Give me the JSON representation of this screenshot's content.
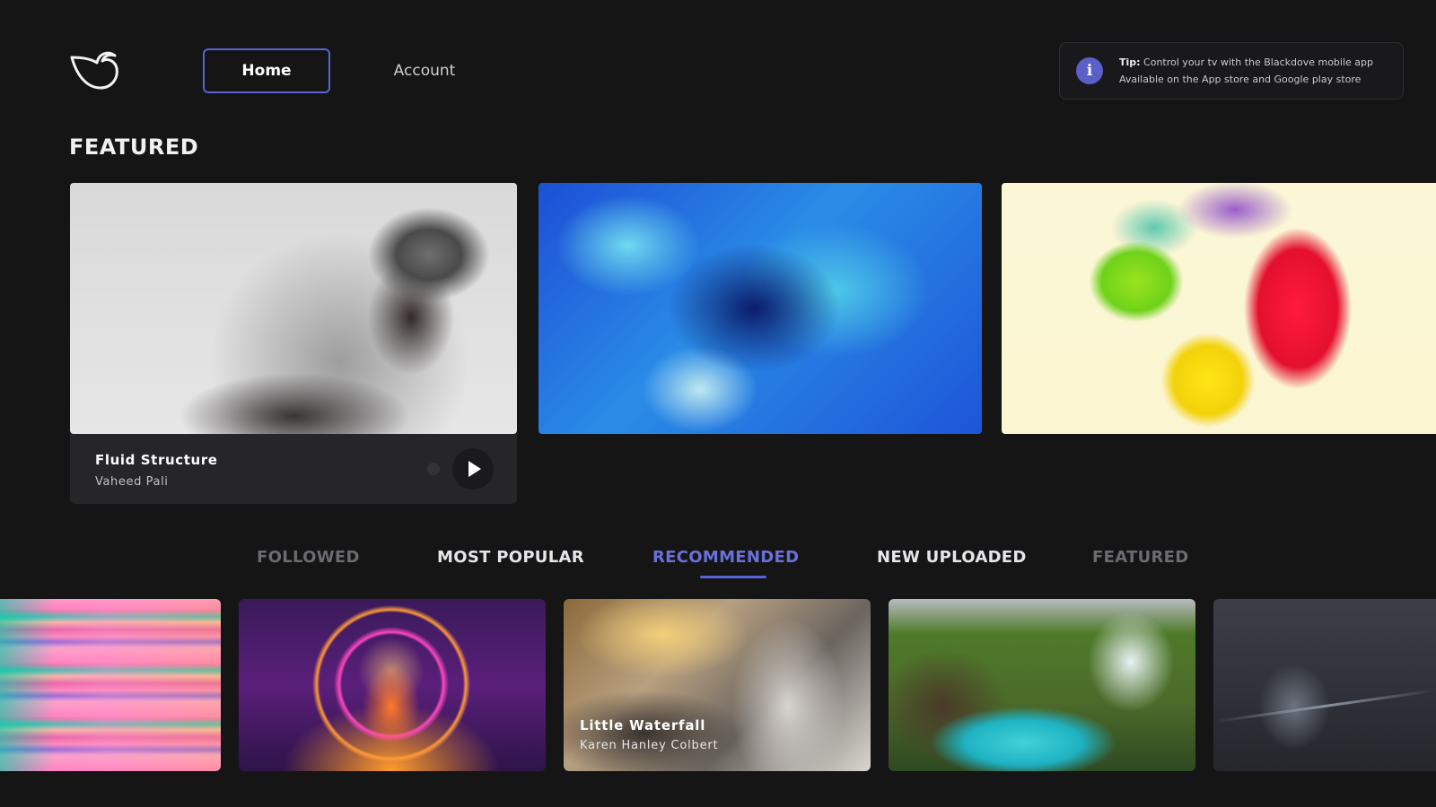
{
  "header": {
    "nav": {
      "home": "Home",
      "account": "Account"
    },
    "tip": {
      "icon": "info-icon",
      "line1_label": "Tip:",
      "line1_text": "Control your tv with the Blackdove mobile app",
      "line2": "Available on the App store and Google play store"
    }
  },
  "featured": {
    "title": "FEATURED",
    "items": [
      {
        "title": "Fluid Structure",
        "author": "Vaheed Pali"
      }
    ]
  },
  "tabs": [
    "FOLLOWED",
    "MOST POPULAR",
    "RECOMMENDED",
    "NEW UPLOADED",
    "FEATURED"
  ],
  "active_tab": "RECOMMENDED",
  "recommended": [
    {
      "title": "Little Waterfall",
      "author": "Karen Hanley Colbert"
    }
  ],
  "colors": {
    "accent": "#5a62d6",
    "background": "#151516",
    "tip_icon": "#5a60c8"
  }
}
